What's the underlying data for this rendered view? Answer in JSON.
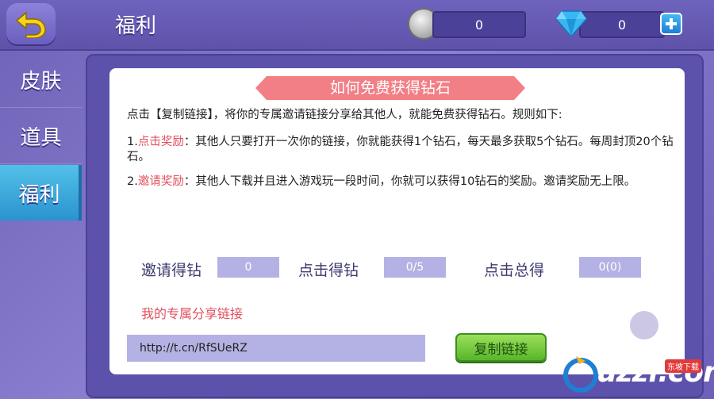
{
  "header": {
    "title": "福利",
    "coin_value": "0",
    "gem_value": "0"
  },
  "sidebar": {
    "items": [
      {
        "label": "皮肤"
      },
      {
        "label": "道具"
      },
      {
        "label": "福利"
      }
    ],
    "active_index": 2
  },
  "panel": {
    "banner": "如何免费获得钻石",
    "intro": "点击【复制链接】，将你的专属邀请链接分享给其他人，就能免费获得钻石。规则如下:",
    "rule1_prefix": "1.",
    "rule1_title": "点击奖励",
    "rule1_text": "：其他人只要打开一次你的链接，你就能获得1个钻石，每天最多获取5个钻石。每周封顶20个钻石。",
    "rule2_prefix": "2.",
    "rule2_title": "邀请奖励",
    "rule2_text": "：其他人下载并且进入游戏玩一段时间，你就可以获得10钻石的奖励。邀请奖励无上限。",
    "stats": [
      {
        "label": "邀请得钻",
        "value": "0"
      },
      {
        "label": "点击得钻",
        "value": "0/5"
      },
      {
        "label": "点击总得",
        "value": "0(0)"
      }
    ],
    "share_title": "我的专属分享链接",
    "share_link": "http://t.cn/RfSUeRZ",
    "copy_button": "复制链接"
  },
  "watermark": {
    "text": "uzzf.com",
    "tag": "东坡下载"
  },
  "colors": {
    "accent_pink": "#f27e86",
    "highlight_red": "#e0505e",
    "active_tab": "#2a93cf",
    "copy_button": "#59b52a"
  }
}
